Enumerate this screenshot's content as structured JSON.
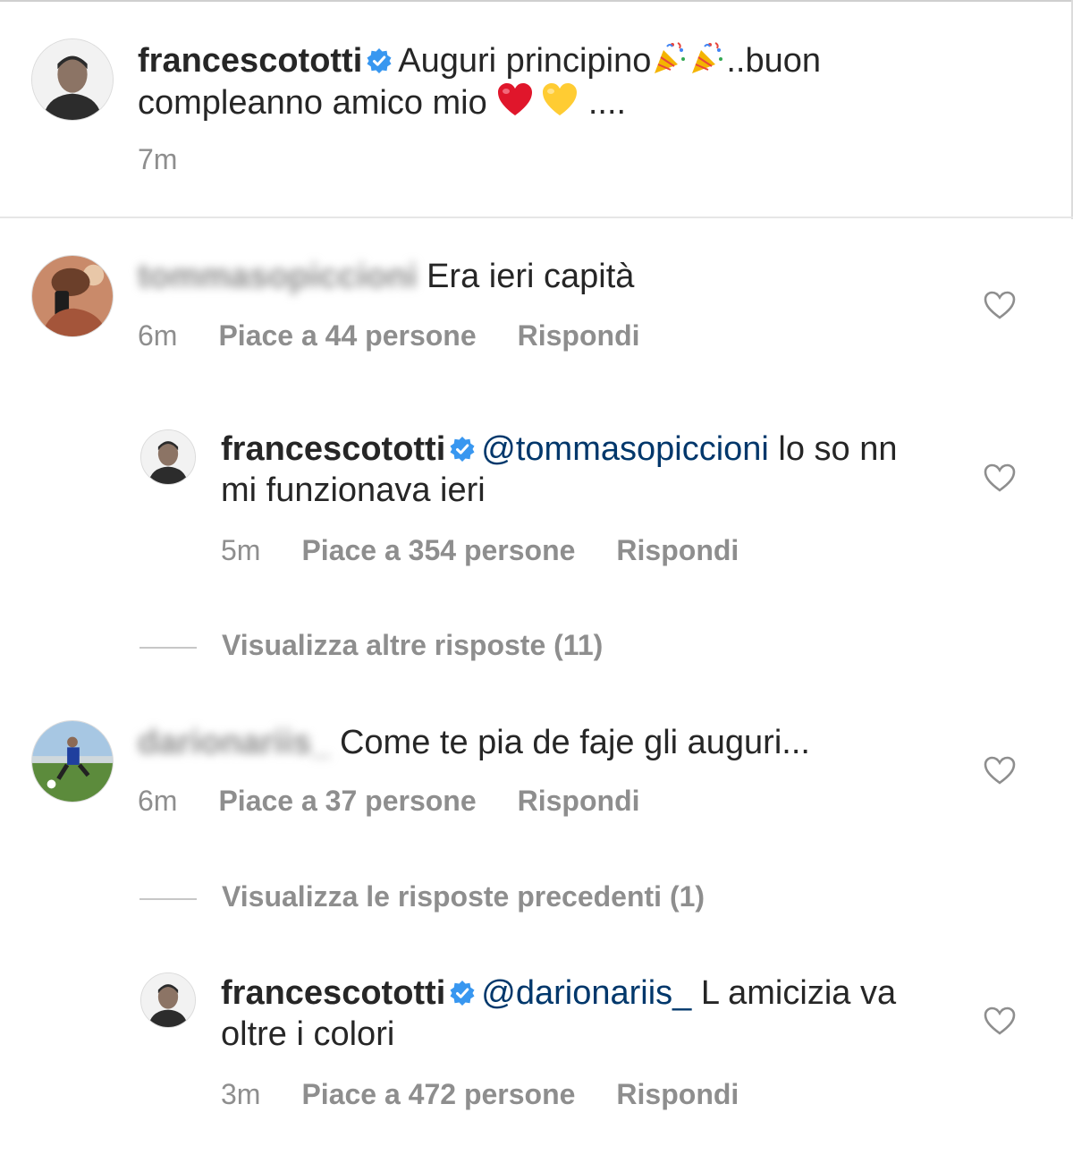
{
  "caption": {
    "username": "francescototti",
    "text_part1": "Auguri principino",
    "text_part2": "..buon compleanno amico mio",
    "text_part3": "....",
    "time": "7m"
  },
  "comments": [
    {
      "username": "tommasopiccioni",
      "text": "Era ieri capità",
      "time": "6m",
      "likes": "Piace a 44 persone",
      "reply_label": "Rispondi"
    },
    {
      "username": "francescototti",
      "mention": "@tommasopiccioni",
      "text": "lo so nn mi funzionava ieri",
      "time": "5m",
      "likes": "Piace a 354 persone",
      "reply_label": "Rispondi"
    },
    {
      "username": "darionariis_",
      "text": "Come te pia de faje gli auguri...",
      "time": "6m",
      "likes": "Piace a 37 persone",
      "reply_label": "Rispondi"
    },
    {
      "username": "francescototti",
      "mention": "@darionariis_",
      "text": "L amicizia va oltre i colori",
      "time": "3m",
      "likes": "Piace a 472 persone",
      "reply_label": "Rispondi"
    }
  ],
  "view_more_1": "Visualizza altre risposte (11)",
  "view_more_2": "Visualizza le risposte precedenti (1)",
  "colors": {
    "verified": "#3897f0",
    "mention": "#00376b",
    "meta": "#8e8e8e",
    "heart_emoji": "#e0162b",
    "yellow_heart": "#ffcc33"
  },
  "icons": [
    "verified-badge-icon",
    "party-popper-icon",
    "red-heart-emoji",
    "yellow-heart-emoji",
    "heart-outline-icon"
  ]
}
